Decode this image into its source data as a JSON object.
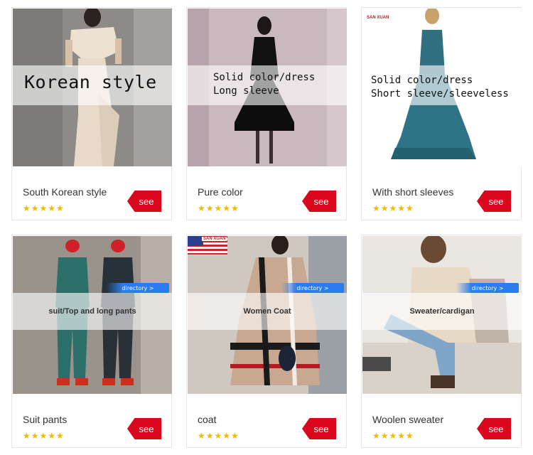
{
  "products": [
    {
      "name": "South Korean style",
      "rating": "★★★★★",
      "see_label": "see",
      "overlay_lines": [
        "Korean style"
      ],
      "brand": "",
      "directory": ""
    },
    {
      "name": "Pure color",
      "rating": "★★★★★",
      "see_label": "see",
      "overlay_lines": [
        "Solid color/dress",
        "Long sleeve"
      ],
      "brand": "",
      "directory": ""
    },
    {
      "name": "With short sleeves",
      "rating": "★★★★★",
      "see_label": "see",
      "overlay_lines": [
        "Solid color/dress",
        "Short sleeve/sleeveless"
      ],
      "brand": "SAN XUAN",
      "directory": ""
    },
    {
      "name": "Suit pants",
      "rating": "★★★★★",
      "see_label": "see",
      "overlay_lines": [
        "suit/Top and long pants"
      ],
      "brand": "",
      "directory": "directory >"
    },
    {
      "name": "coat",
      "rating": "★★★★★",
      "see_label": "see",
      "overlay_lines": [
        "Women Coat"
      ],
      "brand": "SAN XUAN",
      "directory": "directory >"
    },
    {
      "name": "Woolen sweater",
      "rating": "★★★★★",
      "see_label": "see",
      "overlay_lines": [
        "Sweater/cardigan"
      ],
      "brand": "",
      "directory": "directory >"
    }
  ],
  "colors": {
    "see_button": "#d9061c",
    "stars": "#f5b800",
    "directory_tag": "#2a7cf0"
  }
}
